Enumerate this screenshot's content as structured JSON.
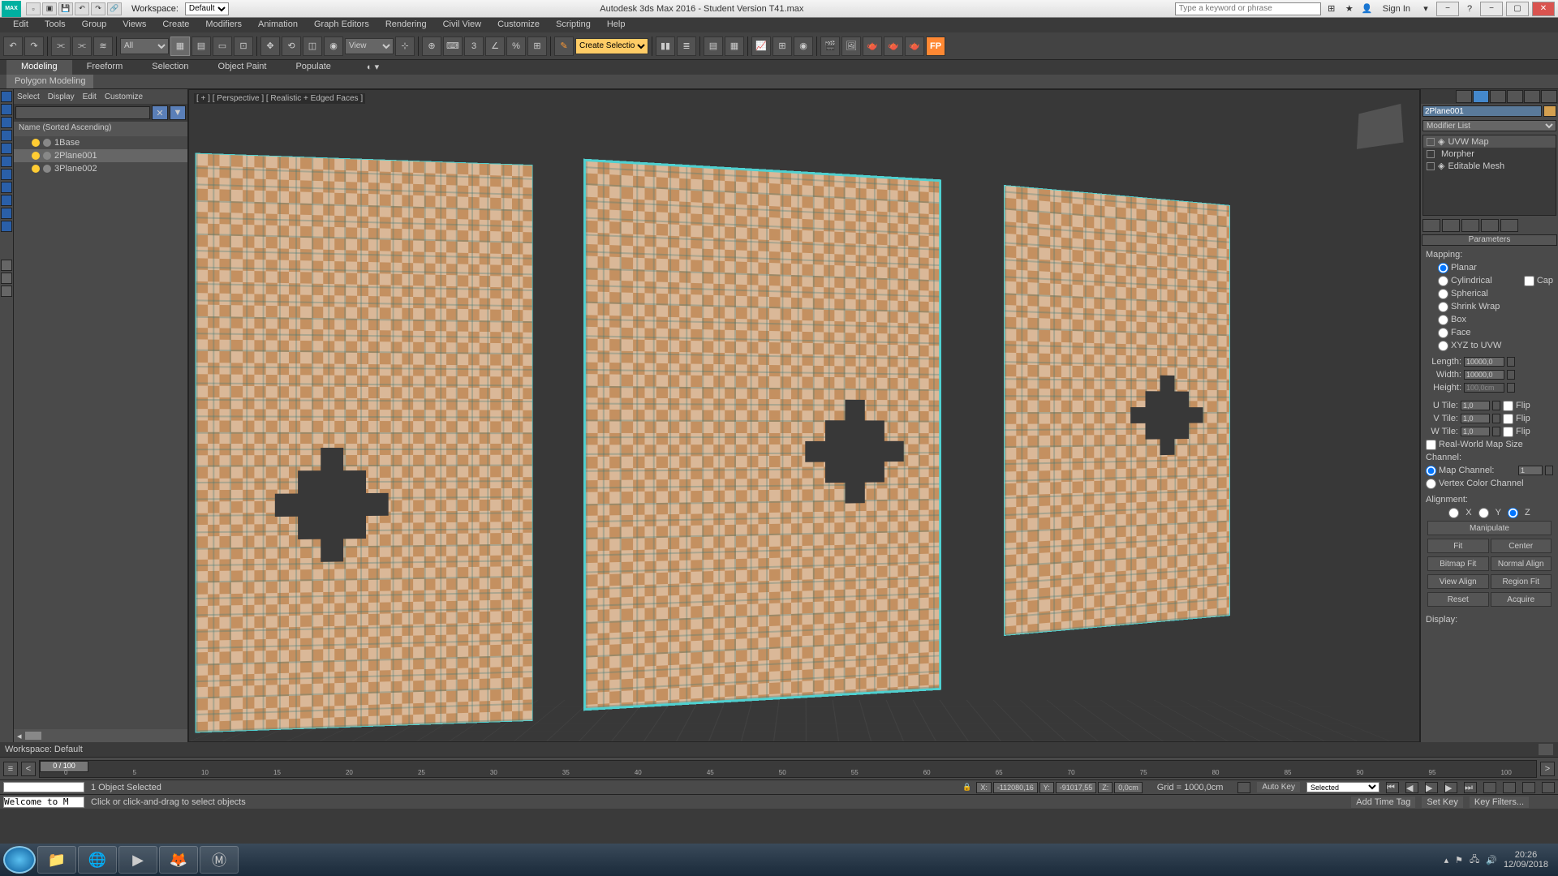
{
  "title": "Autodesk 3ds Max 2016 - Student Version   T41.max",
  "workspace_label": "Workspace:",
  "workspace_value": "Default",
  "menus": [
    "Edit",
    "Tools",
    "Group",
    "Views",
    "Create",
    "Modifiers",
    "Animation",
    "Graph Editors",
    "Rendering",
    "Civil View",
    "Customize",
    "Scripting",
    "Help"
  ],
  "search_placeholder": "Type a keyword or phrase",
  "signin": "Sign In",
  "toolbar": {
    "dd1": "All",
    "dd2": "View",
    "dd3": "Create Selection Se"
  },
  "ribbon": {
    "tabs": [
      "Modeling",
      "Freeform",
      "Selection",
      "Object Paint",
      "Populate"
    ],
    "sub": "Polygon Modeling"
  },
  "outliner": {
    "menus": [
      "Select",
      "Display",
      "Edit",
      "Customize"
    ],
    "header": "Name (Sorted Ascending)",
    "items": [
      "1Base",
      "2Plane001",
      "3Plane002"
    ]
  },
  "viewport": {
    "label": "[ + ] [ Perspective ] [ Realistic + Edged Faces ]"
  },
  "object_name": "2Plane001",
  "modifier_list": "Modifier List",
  "stack": [
    "UVW Map",
    "Morpher",
    "Editable Mesh"
  ],
  "params": {
    "title": "Parameters",
    "mapping": "Mapping:",
    "options": [
      "Planar",
      "Cylindrical",
      "Spherical",
      "Shrink Wrap",
      "Box",
      "Face",
      "XYZ to UVW"
    ],
    "cap": "Cap",
    "length": "Length:",
    "length_v": "10000,0",
    "width": "Width:",
    "width_v": "10000,0",
    "height": "Height:",
    "height_v": "100,0cm",
    "utile": "U Tile:",
    "utile_v": "1,0",
    "vtile": "V Tile:",
    "vtile_v": "1,0",
    "wtile": "W Tile:",
    "wtile_v": "1,0",
    "flip": "Flip",
    "realworld": "Real-World Map Size",
    "channel": "Channel:",
    "mapch": "Map Channel:",
    "mapch_v": "1",
    "vertexcol": "Vertex Color Channel",
    "alignment": "Alignment:",
    "axes": [
      "X",
      "Y",
      "Z"
    ],
    "manip": "Manipulate",
    "fit": "Fit",
    "center": "Center",
    "bitmapfit": "Bitmap Fit",
    "normalalign": "Normal Align",
    "viewalign": "View Align",
    "regionfit": "Region Fit",
    "reset": "Reset",
    "acquire": "Acquire",
    "display": "Display:"
  },
  "ws_status": "Workspace: Default",
  "timeline": {
    "pos": "0 / 100",
    "ticks": [
      "0",
      "5",
      "10",
      "15",
      "20",
      "25",
      "30",
      "35",
      "40",
      "45",
      "50",
      "55",
      "60",
      "65",
      "70",
      "75",
      "80",
      "85",
      "90",
      "95",
      "100"
    ]
  },
  "status": {
    "selected": "1 Object Selected",
    "x": "X:",
    "x_v": "-112080,16",
    "y": "Y:",
    "y_v": "-91017,55",
    "z": "Z:",
    "z_v": "0,0cm",
    "grid": "Grid = 1000,0cm",
    "autokey": "Auto Key",
    "setkey": "Set Key",
    "keyfilters": "Key Filters...",
    "selected_dd": "Selected",
    "welcome": "Welcome to M",
    "hint": "Click or click-and-drag to select objects",
    "addtag": "Add Time Tag"
  },
  "clock": {
    "time": "20:26",
    "date": "12/09/2018"
  }
}
